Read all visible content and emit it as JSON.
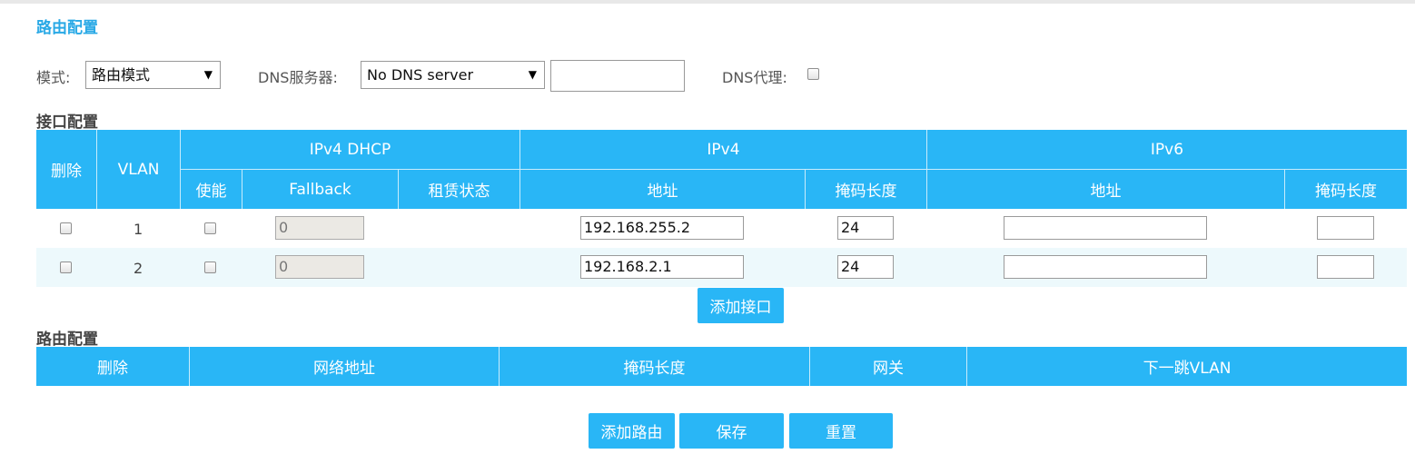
{
  "page": {
    "title": "路由配置"
  },
  "settings": {
    "mode_label": "模式:",
    "mode_value": "路由模式",
    "dns_label": "DNS服务器:",
    "dns_value": "No DNS server",
    "dns_extra_value": "",
    "dns_proxy_label": "DNS代理:",
    "dns_proxy_checked": false
  },
  "interface": {
    "section_title": "接口配置",
    "headers": {
      "delete": "删除",
      "vlan": "VLAN",
      "ipv4_dhcp": "IPv4 DHCP",
      "ipv4": "IPv4",
      "ipv6": "IPv6",
      "enable": "使能",
      "fallback": "Fallback",
      "lease_status": "租赁状态",
      "ipv4_address": "地址",
      "ipv4_mask": "掩码长度",
      "ipv6_address": "地址",
      "ipv6_mask": "掩码长度"
    },
    "rows": [
      {
        "vlan": "1",
        "fallback": "0",
        "ipv4_address": "192.168.255.2",
        "ipv4_mask": "24",
        "ipv6_address": "",
        "ipv6_mask": ""
      },
      {
        "vlan": "2",
        "fallback": "0",
        "ipv4_address": "192.168.2.1",
        "ipv4_mask": "24",
        "ipv6_address": "",
        "ipv6_mask": ""
      }
    ],
    "add_button": "添加接口"
  },
  "routes": {
    "section_title": "路由配置",
    "headers": {
      "delete": "删除",
      "network": "网络地址",
      "mask": "掩码长度",
      "gateway": "网关",
      "next_hop_vlan": "下一跳VLAN"
    }
  },
  "buttons": {
    "add_route": "添加路由",
    "save": "保存",
    "reset": "重置"
  },
  "colors": {
    "accent": "#29b6f6",
    "title": "#29a9e6",
    "row_alt": "#edf9fc"
  }
}
